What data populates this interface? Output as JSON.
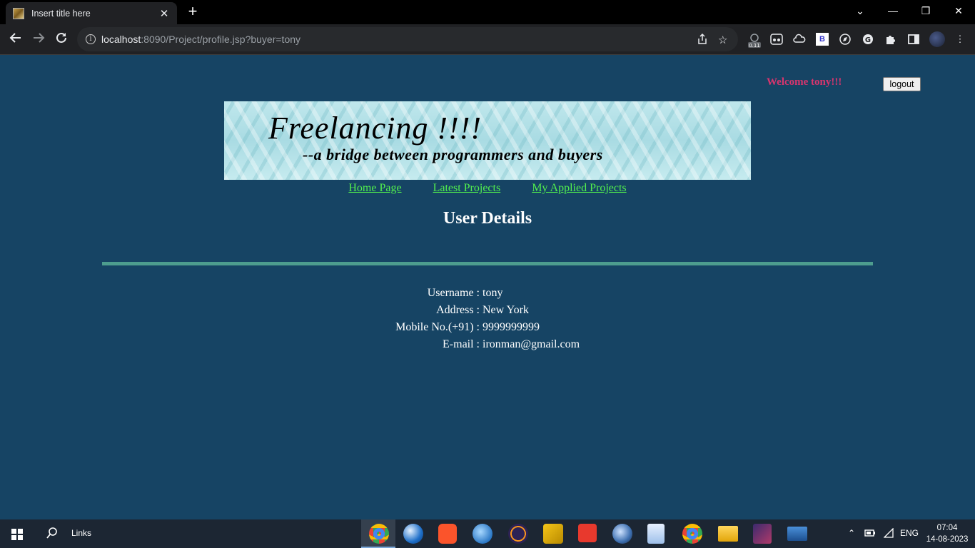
{
  "browser": {
    "tab_title": "Insert title here",
    "tab_close": "✕",
    "new_tab": "+",
    "window_controls": [
      "⌄",
      "—",
      "❐",
      "✕"
    ],
    "url_host": "localhost",
    "url_rest": ":8090/Project/profile.jsp?buyer=tony",
    "extension_badge": "0.11"
  },
  "page": {
    "welcome": "Welcome tony!!!",
    "logout_label": "logout",
    "banner_title": "Freelancing !!!!",
    "banner_subtitle": "--a bridge between programmers and buyers",
    "nav": [
      "Home Page",
      "Latest Projects",
      "My Applied Projects"
    ],
    "heading": "User Details",
    "details": [
      {
        "label": "Username :",
        "value": "tony"
      },
      {
        "label": "Address :",
        "value": "New York"
      },
      {
        "label": "Mobile No.(+91) :",
        "value": "9999999999"
      },
      {
        "label": "E-mail :",
        "value": "ironman@gmail.com"
      }
    ]
  },
  "taskbar": {
    "links_label": "Links",
    "language": "ENG",
    "time": "07:04",
    "date": "14-08-2023"
  },
  "colors": {
    "page_bg": "#164464",
    "welcome": "#d8356e",
    "link": "#52f04e",
    "divider": "#4d9d8e"
  }
}
